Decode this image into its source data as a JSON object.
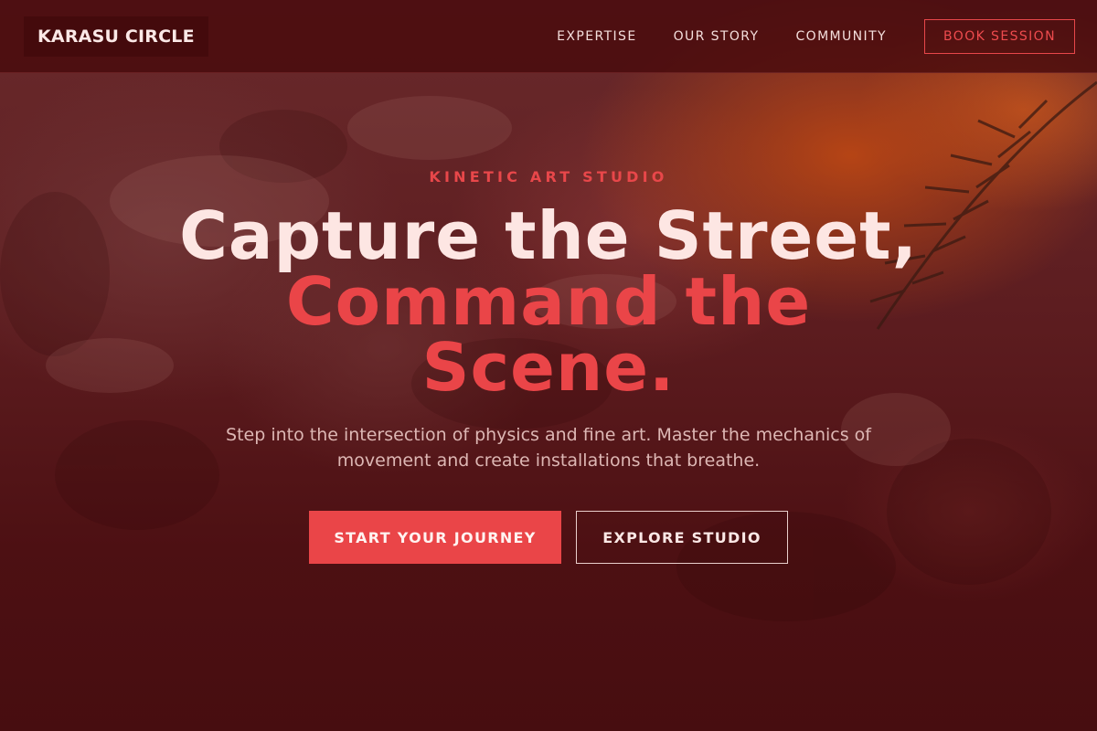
{
  "brand": {
    "name": "KARASU CIRCLE"
  },
  "nav": {
    "links": [
      {
        "label": "EXPERTISE"
      },
      {
        "label": "OUR STORY"
      },
      {
        "label": "COMMUNITY"
      }
    ],
    "cta_label": "BOOK SESSION"
  },
  "hero": {
    "eyebrow": "KINETIC ART STUDIO",
    "headline_line1": "Capture the Street,",
    "headline_accent_line1": "Command the",
    "headline_accent_line2": "Scene.",
    "subtext": "Step into the intersection of physics and fine art. Master the mechanics of movement and create installations that breathe.",
    "primary_cta": "START YOUR JOURNEY",
    "secondary_cta": "EXPLORE STUDIO"
  },
  "colors": {
    "accent": "#ea4548",
    "background": "#4a0e10",
    "text_light": "#fde6e3"
  }
}
